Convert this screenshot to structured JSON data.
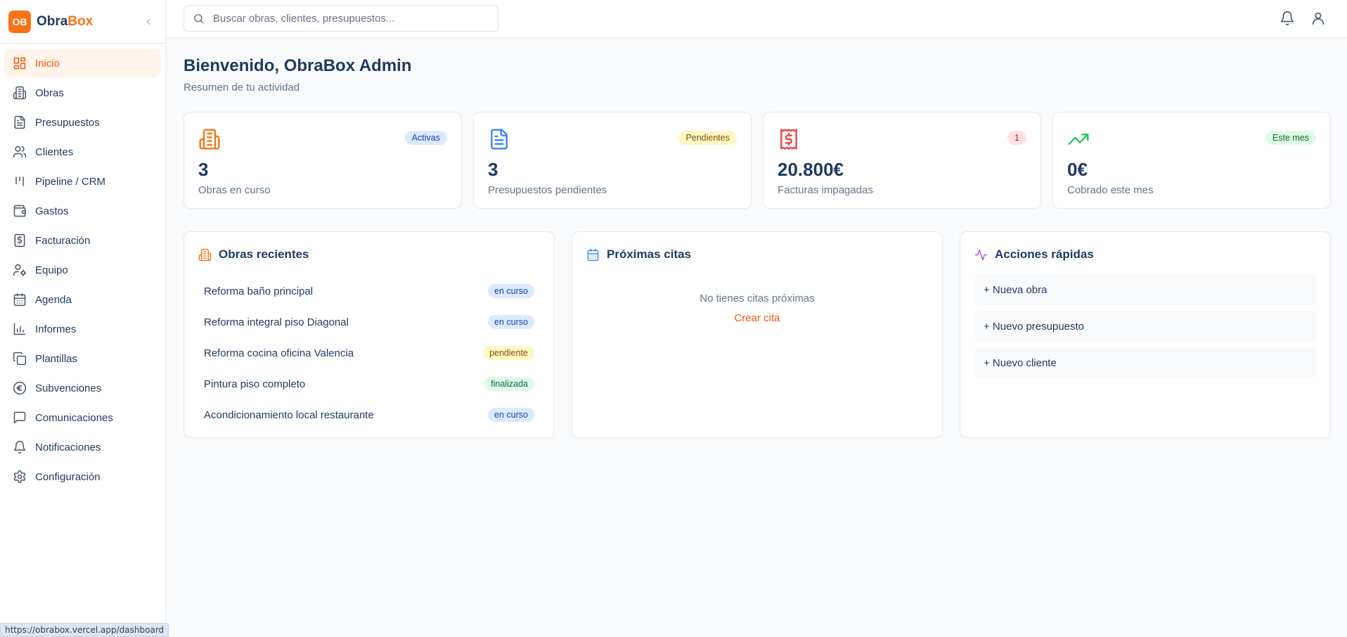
{
  "brand": {
    "logo_text": "OB",
    "name_part1": "Obra",
    "name_part2": "Box",
    "accent_color": "#f97316"
  },
  "sidebar": {
    "items": [
      {
        "label": "Inicio",
        "icon": "layout-dashboard-icon",
        "active": true
      },
      {
        "label": "Obras",
        "icon": "building-icon"
      },
      {
        "label": "Presupuestos",
        "icon": "file-text-icon"
      },
      {
        "label": "Clientes",
        "icon": "users-icon"
      },
      {
        "label": "Pipeline / CRM",
        "icon": "kanban-icon"
      },
      {
        "label": "Gastos",
        "icon": "wallet-icon"
      },
      {
        "label": "Facturación",
        "icon": "receipt-icon"
      },
      {
        "label": "Equipo",
        "icon": "user-cog-icon"
      },
      {
        "label": "Agenda",
        "icon": "calendar-icon"
      },
      {
        "label": "Informes",
        "icon": "bar-chart-icon"
      },
      {
        "label": "Plantillas",
        "icon": "copy-icon"
      },
      {
        "label": "Subvenciones",
        "icon": "euro-icon"
      },
      {
        "label": "Comunicaciones",
        "icon": "message-square-icon"
      },
      {
        "label": "Notificaciones",
        "icon": "bell-icon"
      },
      {
        "label": "Configuración",
        "icon": "settings-icon"
      }
    ]
  },
  "status_url": "https://obrabox.vercel.app/dashboard",
  "search": {
    "placeholder": "Buscar obras, clientes, presupuestos..."
  },
  "header": {
    "title": "Bienvenido, ObraBox Admin",
    "subtitle": "Resumen de tu actividad"
  },
  "stats": [
    {
      "value": "3",
      "label": "Obras en curso",
      "badge": "Activas",
      "icon": "building-icon",
      "color": "#f97316"
    },
    {
      "value": "3",
      "label": "Presupuestos pendientes",
      "badge": "Pendientes",
      "icon": "file-text-icon",
      "color": "#3b82f6"
    },
    {
      "value": "20.800€",
      "label": "Facturas impagadas",
      "badge": "1",
      "icon": "receipt-icon",
      "color": "#ef4444"
    },
    {
      "value": "0€",
      "label": "Cobrado este mes",
      "badge": "Este mes",
      "icon": "trending-up-icon",
      "color": "#22c55e"
    }
  ],
  "recent_works": {
    "title": "Obras recientes",
    "items": [
      {
        "name": "Reforma baño principal",
        "status": "en curso"
      },
      {
        "name": "Reforma integral piso Diagonal",
        "status": "en curso"
      },
      {
        "name": "Reforma cocina oficina Valencia",
        "status": "pendiente"
      },
      {
        "name": "Pintura piso completo",
        "status": "finalizada"
      },
      {
        "name": "Acondicionamiento local restaurante",
        "status": "en curso"
      }
    ]
  },
  "appointments": {
    "title": "Próximas citas",
    "empty_text": "No tienes citas próximas",
    "create_link": "Crear cita"
  },
  "quick_actions": {
    "title": "Acciones rápidas",
    "items": [
      "+ Nueva obra",
      "+ Nuevo presupuesto",
      "+ Nuevo cliente"
    ]
  }
}
